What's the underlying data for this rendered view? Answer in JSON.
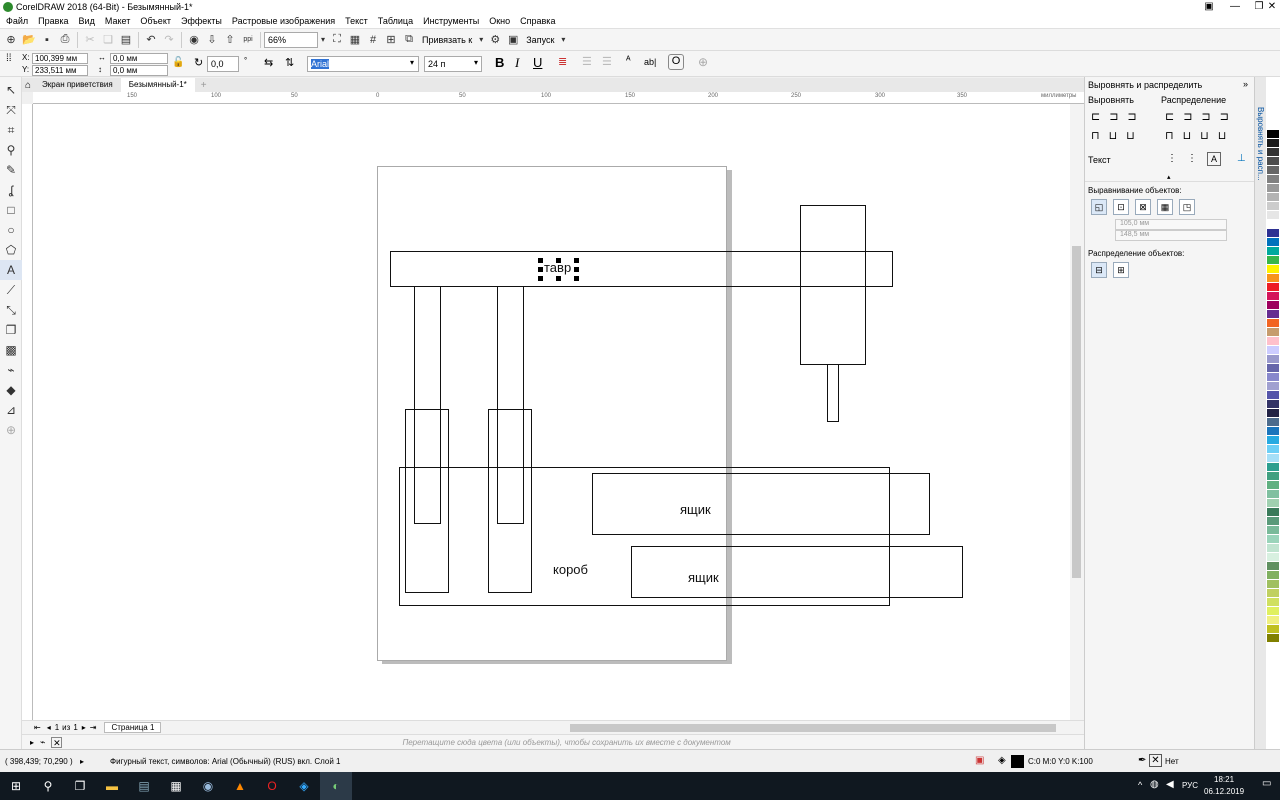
{
  "window": {
    "title": "CorelDRAW 2018 (64-Bit) - Безымянный-1*"
  },
  "menu": [
    "Файл",
    "Правка",
    "Вид",
    "Макет",
    "Объект",
    "Эффекты",
    "Растровые изображения",
    "Текст",
    "Таблица",
    "Инструменты",
    "Окно",
    "Справка"
  ],
  "toolbar1": {
    "zoom": "66%",
    "snap_label": "Привязать к",
    "launch_label": "Запуск",
    "dpi_label": "ppi"
  },
  "toolbar2": {
    "x": "100,399 мм",
    "y": "233,511 мм",
    "w": "0,0 мм",
    "h": "0,0 мм",
    "angle": "0,0",
    "font": "Arial",
    "size": "24 п",
    "x_lbl": "X:",
    "y_lbl": "Y:"
  },
  "tabs": {
    "welcome": "Экран приветствия",
    "doc": "Безымянный-1*"
  },
  "ruler_h": [
    "150",
    "100",
    "50",
    "0",
    "50",
    "100",
    "150",
    "200",
    "250",
    "300",
    "350",
    "миллиметры"
  ],
  "canvas": {
    "labels": {
      "tavr": "тавр",
      "yashik1": "ящик",
      "yashik2": "ящик",
      "korob": "короб"
    }
  },
  "pagenav": {
    "current": "1",
    "of": "из",
    "total": "1",
    "page_tab": "Страница 1"
  },
  "palette_hint": "Перетащите сюда цвета (или объекты), чтобы сохранить их вместе с документом",
  "docker": {
    "title": "Выровнять и распределить",
    "align": "Выровнять",
    "distribute": "Распределение",
    "text": "Текст",
    "align_objects": "Выравнивание объектов:",
    "x_val": "105,0 мм",
    "y_val": "148,5 мм",
    "distribute_objects": "Распределение объектов:",
    "side_tab": "Выровнять и расп..."
  },
  "status": {
    "coords": "( 398,439; 70,290 )",
    "info": "Фигурный текст, символов: Arial (Обычный) (RUS) вкл. Слой 1",
    "color": "C:0 M:0 Y:0 K:100",
    "outline": "Нет"
  },
  "taskbar": {
    "lang": "РУС",
    "time": "18:21",
    "date": "06.12.2019"
  },
  "colors": [
    "#ffffff",
    "#000000",
    "#1a1a1a",
    "#333333",
    "#4d4d4d",
    "#666666",
    "#808080",
    "#999999",
    "#b3b3b3",
    "#cccccc",
    "#e6e6e6",
    "#ffffff",
    "#2e3192",
    "#0071bc",
    "#00a99d",
    "#39b54a",
    "#fff200",
    "#f7941d",
    "#ed1c24",
    "#d4145a",
    "#9e005d",
    "#662d91",
    "#f26522",
    "#c69c6d",
    "#ffc0cb",
    "#ccccff",
    "#9999cc",
    "#6666aa",
    "#8888cc",
    "#a0a0d0",
    "#5555aa",
    "#333366",
    "#222244",
    "#4d6b8c",
    "#1b75bc",
    "#27aae1",
    "#6dcff6",
    "#a6dff7",
    "#2b9f8f",
    "#40a080",
    "#60b080",
    "#80c0a0",
    "#a0d0b0",
    "#3a7a5a",
    "#5a9a7a",
    "#7aba9a",
    "#9ad4ba",
    "#c0e4d0",
    "#d8f0e0",
    "#609060",
    "#80b060",
    "#a0c060",
    "#c0d060",
    "#d0e060",
    "#e0f060",
    "#f0f080",
    "#c0c020",
    "#808000"
  ]
}
